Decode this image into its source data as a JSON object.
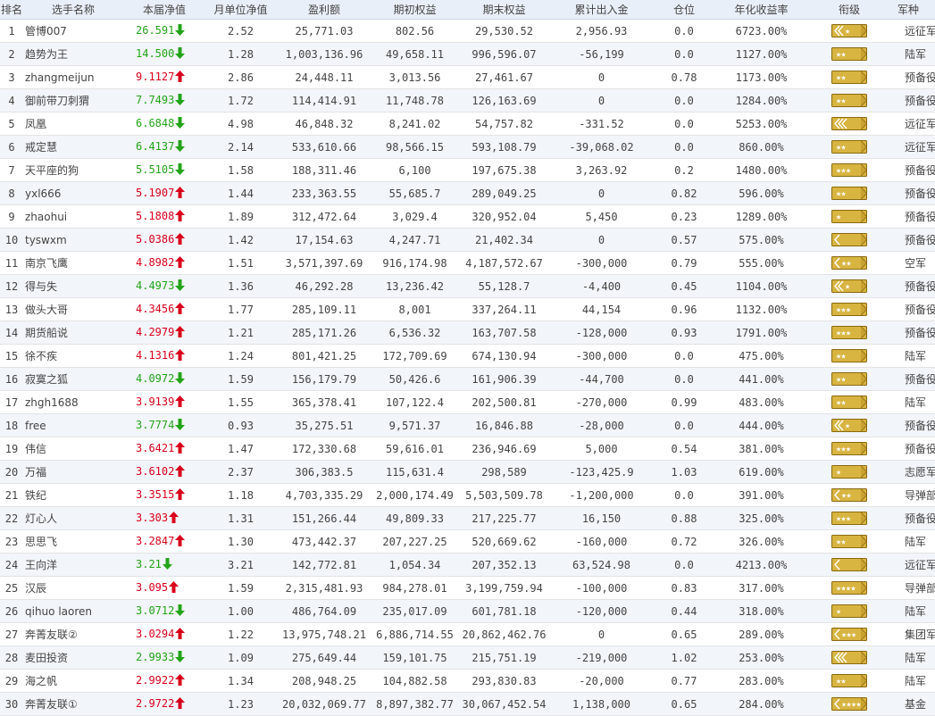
{
  "colors": {
    "up": "#d9001b",
    "down": "#22a418",
    "badge_fill": "#d8b441",
    "badge_border": "#8a6a10"
  },
  "headers": [
    "排名",
    "选手名称",
    "本届净值",
    "月单位净值",
    "盈利额",
    "期初权益",
    "期末权益",
    "累计出入金",
    "仓位",
    "年化收益率",
    "衔级",
    "军种"
  ],
  "rows": [
    {
      "rank": "1",
      "name": "管博007",
      "nav": "26.591",
      "dir": "down",
      "month": "2.52",
      "profit": "25,771.03",
      "begin": "802.56",
      "end": "29,530.52",
      "flow": "2,956.93",
      "pos": "0.0",
      "annual": "6723.00%",
      "badge": "chevron2-star1",
      "army": "远征军"
    },
    {
      "rank": "2",
      "name": "趋势为王",
      "nav": "14.500",
      "dir": "down",
      "month": "1.28",
      "profit": "1,003,136.96",
      "begin": "49,658.11",
      "end": "996,596.07",
      "flow": "-56,199",
      "pos": "0.0",
      "annual": "1127.00%",
      "badge": "bar-star2",
      "army": "陆军"
    },
    {
      "rank": "3",
      "name": "zhangmeijun",
      "nav": "9.1127",
      "dir": "up",
      "month": "2.86",
      "profit": "24,448.11",
      "begin": "3,013.56",
      "end": "27,461.67",
      "flow": "0",
      "pos": "0.78",
      "annual": "1173.00%",
      "badge": "bar-star2",
      "army": "预备役"
    },
    {
      "rank": "4",
      "name": "御前带刀刺猬",
      "nav": "7.7493",
      "dir": "down",
      "month": "1.72",
      "profit": "114,414.91",
      "begin": "11,748.78",
      "end": "126,163.69",
      "flow": "0",
      "pos": "0.0",
      "annual": "1284.00%",
      "badge": "bar-star2",
      "army": "预备役"
    },
    {
      "rank": "5",
      "name": "凤凰",
      "nav": "6.6848",
      "dir": "down",
      "month": "4.98",
      "profit": "46,848.32",
      "begin": "8,241.02",
      "end": "54,757.82",
      "flow": "-331.52",
      "pos": "0.0",
      "annual": "5253.00%",
      "badge": "chevron3",
      "army": "远征军"
    },
    {
      "rank": "6",
      "name": "戒定慧",
      "nav": "6.4137",
      "dir": "down",
      "month": "2.14",
      "profit": "533,610.66",
      "begin": "98,566.15",
      "end": "593,108.79",
      "flow": "-39,068.02",
      "pos": "0.0",
      "annual": "860.00%",
      "badge": "bar-star2",
      "army": "远征军"
    },
    {
      "rank": "7",
      "name": "天平座的狗",
      "nav": "5.5105",
      "dir": "down",
      "month": "1.58",
      "profit": "188,311.46",
      "begin": "6,100",
      "end": "197,675.38",
      "flow": "3,263.92",
      "pos": "0.2",
      "annual": "1480.00%",
      "badge": "bar-star3",
      "army": "预备役"
    },
    {
      "rank": "8",
      "name": "yxl666",
      "nav": "5.1907",
      "dir": "up",
      "month": "1.44",
      "profit": "233,363.55",
      "begin": "55,685.7",
      "end": "289,049.25",
      "flow": "0",
      "pos": "0.82",
      "annual": "596.00%",
      "badge": "bar-star2",
      "army": "预备役"
    },
    {
      "rank": "9",
      "name": "zhaohui",
      "nav": "5.1808",
      "dir": "up",
      "month": "1.89",
      "profit": "312,472.64",
      "begin": "3,029.4",
      "end": "320,952.04",
      "flow": "5,450",
      "pos": "0.23",
      "annual": "1289.00%",
      "badge": "bar-star1",
      "army": "预备役"
    },
    {
      "rank": "10",
      "name": "tyswxm",
      "nav": "5.0386",
      "dir": "up",
      "month": "1.42",
      "profit": "17,154.63",
      "begin": "4,247.71",
      "end": "21,402.34",
      "flow": "0",
      "pos": "0.57",
      "annual": "575.00%",
      "badge": "chevron1",
      "army": "预备役"
    },
    {
      "rank": "11",
      "name": "南京飞鹰",
      "nav": "4.8982",
      "dir": "up",
      "month": "1.51",
      "profit": "3,571,397.69",
      "begin": "916,174.98",
      "end": "4,187,572.67",
      "flow": "-300,000",
      "pos": "0.79",
      "annual": "555.00%",
      "badge": "chevron1-star2",
      "army": "空军"
    },
    {
      "rank": "12",
      "name": "得与失",
      "nav": "4.4973",
      "dir": "down",
      "month": "1.36",
      "profit": "46,292.28",
      "begin": "13,236.42",
      "end": "55,128.7",
      "flow": "-4,400",
      "pos": "0.45",
      "annual": "1104.00%",
      "badge": "chevron2-star1",
      "army": "预备役"
    },
    {
      "rank": "13",
      "name": "做头大哥",
      "nav": "4.3456",
      "dir": "up",
      "month": "1.77",
      "profit": "285,109.11",
      "begin": "8,001",
      "end": "337,264.11",
      "flow": "44,154",
      "pos": "0.96",
      "annual": "1132.00%",
      "badge": "bar-star3",
      "army": "预备役"
    },
    {
      "rank": "14",
      "name": "期货船说",
      "nav": "4.2979",
      "dir": "up",
      "month": "1.21",
      "profit": "285,171.26",
      "begin": "6,536.32",
      "end": "163,707.58",
      "flow": "-128,000",
      "pos": "0.93",
      "annual": "1791.00%",
      "badge": "bar-star3",
      "army": "预备役"
    },
    {
      "rank": "15",
      "name": "徐不疾",
      "nav": "4.1316",
      "dir": "up",
      "month": "1.24",
      "profit": "801,421.25",
      "begin": "172,709.69",
      "end": "674,130.94",
      "flow": "-300,000",
      "pos": "0.0",
      "annual": "475.00%",
      "badge": "bar-star2",
      "army": "陆军"
    },
    {
      "rank": "16",
      "name": "寂寞之狐",
      "nav": "4.0972",
      "dir": "down",
      "month": "1.59",
      "profit": "156,179.79",
      "begin": "50,426.6",
      "end": "161,906.39",
      "flow": "-44,700",
      "pos": "0.0",
      "annual": "441.00%",
      "badge": "bar-star2",
      "army": "预备役"
    },
    {
      "rank": "17",
      "name": "zhgh1688",
      "nav": "3.9139",
      "dir": "up",
      "month": "1.55",
      "profit": "365,378.41",
      "begin": "107,122.4",
      "end": "202,500.81",
      "flow": "-270,000",
      "pos": "0.99",
      "annual": "483.00%",
      "badge": "bar-star2",
      "army": "陆军"
    },
    {
      "rank": "18",
      "name": "free",
      "nav": "3.7774",
      "dir": "down",
      "month": "0.93",
      "profit": "35,275.51",
      "begin": "9,571.37",
      "end": "16,846.88",
      "flow": "-28,000",
      "pos": "0.0",
      "annual": "444.00%",
      "badge": "chevron2-star1",
      "army": "预备役"
    },
    {
      "rank": "19",
      "name": "伟信",
      "nav": "3.6421",
      "dir": "up",
      "month": "1.47",
      "profit": "172,330.68",
      "begin": "59,616.01",
      "end": "236,946.69",
      "flow": "5,000",
      "pos": "0.54",
      "annual": "381.00%",
      "badge": "bar-star3",
      "army": "预备役"
    },
    {
      "rank": "20",
      "name": "万福",
      "nav": "3.6102",
      "dir": "up",
      "month": "2.37",
      "profit": "306,383.5",
      "begin": "115,631.4",
      "end": "298,589",
      "flow": "-123,425.9",
      "pos": "1.03",
      "annual": "619.00%",
      "badge": "bar-star1",
      "army": "志愿军"
    },
    {
      "rank": "21",
      "name": "铁纪",
      "nav": "3.3515",
      "dir": "up",
      "month": "1.18",
      "profit": "4,703,335.29",
      "begin": "2,000,174.49",
      "end": "5,503,509.78",
      "flow": "-1,200,000",
      "pos": "0.0",
      "annual": "391.00%",
      "badge": "chevron1-star2",
      "army": "导弹部"
    },
    {
      "rank": "22",
      "name": "灯心人",
      "nav": "3.303",
      "dir": "up",
      "month": "1.31",
      "profit": "151,266.44",
      "begin": "49,809.33",
      "end": "217,225.77",
      "flow": "16,150",
      "pos": "0.88",
      "annual": "325.00%",
      "badge": "bar-star3",
      "army": "预备役"
    },
    {
      "rank": "23",
      "name": "思思飞",
      "nav": "3.2847",
      "dir": "up",
      "month": "1.30",
      "profit": "473,442.37",
      "begin": "207,227.25",
      "end": "520,669.62",
      "flow": "-160,000",
      "pos": "0.72",
      "annual": "326.00%",
      "badge": "bar-star2",
      "army": "陆军"
    },
    {
      "rank": "24",
      "name": "王向洋",
      "nav": "3.21",
      "dir": "down",
      "month": "3.21",
      "profit": "142,772.81",
      "begin": "1,054.34",
      "end": "207,352.13",
      "flow": "63,524.98",
      "pos": "0.0",
      "annual": "4213.00%",
      "badge": "chevron1",
      "army": "远征军"
    },
    {
      "rank": "25",
      "name": "汉辰",
      "nav": "3.095",
      "dir": "up",
      "month": "1.59",
      "profit": "2,315,481.93",
      "begin": "984,278.01",
      "end": "3,199,759.94",
      "flow": "-100,000",
      "pos": "0.83",
      "annual": "317.00%",
      "badge": "bar-star4",
      "army": "导弹部"
    },
    {
      "rank": "26",
      "name": "qihuo laoren",
      "nav": "3.0712",
      "dir": "down",
      "month": "1.00",
      "profit": "486,764.09",
      "begin": "235,017.09",
      "end": "601,781.18",
      "flow": "-120,000",
      "pos": "0.44",
      "annual": "318.00%",
      "badge": "bar-star1",
      "army": "陆军"
    },
    {
      "rank": "27",
      "name": "奔菁友联②",
      "nav": "3.0294",
      "dir": "up",
      "month": "1.22",
      "profit": "13,975,748.21",
      "begin": "6,886,714.55",
      "end": "20,862,462.76",
      "flow": "0",
      "pos": "0.65",
      "annual": "289.00%",
      "badge": "chevron1-star3",
      "army": "集团军"
    },
    {
      "rank": "28",
      "name": "麦田投资",
      "nav": "2.9933",
      "dir": "down",
      "month": "1.09",
      "profit": "275,649.44",
      "begin": "159,101.75",
      "end": "215,751.19",
      "flow": "-219,000",
      "pos": "1.02",
      "annual": "253.00%",
      "badge": "chevron3",
      "army": "陆军"
    },
    {
      "rank": "29",
      "name": "海之帆",
      "nav": "2.9922",
      "dir": "up",
      "month": "1.34",
      "profit": "208,948.25",
      "begin": "104,882.58",
      "end": "293,830.83",
      "flow": "-20,000",
      "pos": "0.77",
      "annual": "283.00%",
      "badge": "bar-star2",
      "army": "陆军"
    },
    {
      "rank": "30",
      "name": "奔菁友联①",
      "nav": "2.9722",
      "dir": "up",
      "month": "1.23",
      "profit": "20,032,069.77",
      "begin": "8,897,382.77",
      "end": "30,067,452.54",
      "flow": "1,138,000",
      "pos": "0.65",
      "annual": "284.00%",
      "badge": "chevron1-star4",
      "army": "基金"
    }
  ]
}
